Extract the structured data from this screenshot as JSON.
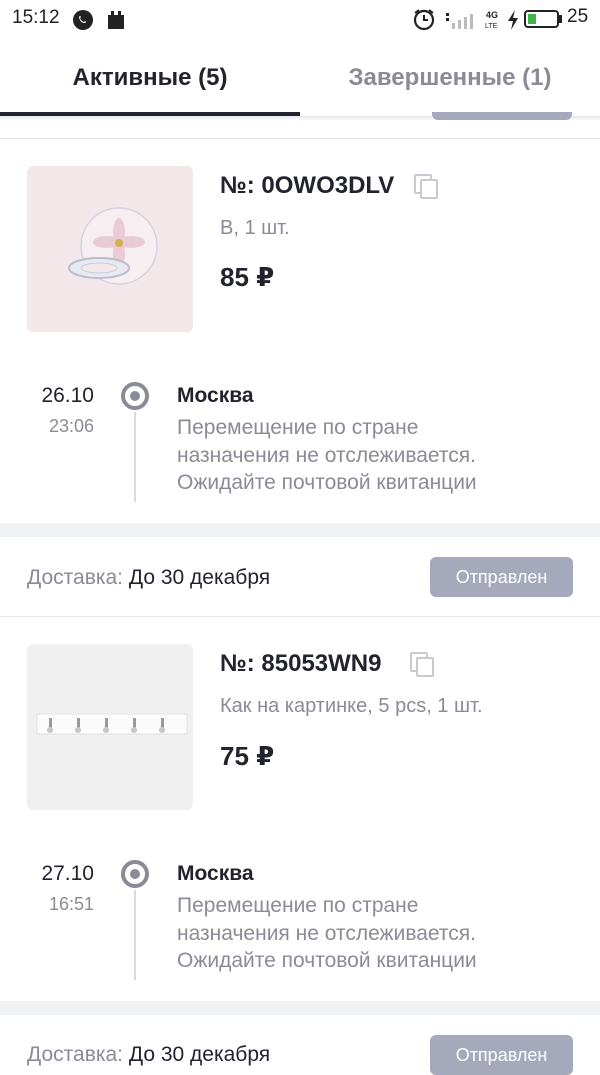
{
  "status_bar": {
    "time": "15:12",
    "battery": "25",
    "network": "4G LTE"
  },
  "tabs": {
    "active": "Активные (5)",
    "completed": "Завершенные (1)"
  },
  "orders": [
    {
      "number": "№: 0OWO3DLV",
      "variant": "В, 1 шт.",
      "price": "85 ₽",
      "tracking": {
        "date": "26.10",
        "time": "23:06",
        "city": "Москва",
        "desc_line1": "Перемещение по стране",
        "desc_line2": "назначения не отслеживается.",
        "desc_line3": "Ожидайте почтовой квитанции"
      },
      "delivery_label": "Доставка:",
      "delivery_value": "До 30 декабря",
      "status": "Отправлен"
    },
    {
      "number": "№: 85053WN9",
      "variant": "Как на картинке, 5 pcs, 1 шт.",
      "price": "75 ₽",
      "tracking": {
        "date": "27.10",
        "time": "16:51",
        "city": "Москва",
        "desc_line1": "Перемещение по стране",
        "desc_line2": "назначения не отслеживается.",
        "desc_line3": "Ожидайте почтовой квитанции"
      },
      "delivery_label": "Доставка:",
      "delivery_value": "До 30 декабря",
      "status": "Отправлен"
    }
  ],
  "colors": {
    "text": "#22232e",
    "muted": "#8a8b96",
    "status_button": "#a6a9bb",
    "separator": "#f0f2f4"
  },
  "icons": [
    "whatsapp-icon",
    "notification-icon",
    "alarm-icon",
    "signal-icon",
    "charging-icon",
    "battery-icon",
    "copy-icon",
    "timeline-dot-icon"
  ]
}
